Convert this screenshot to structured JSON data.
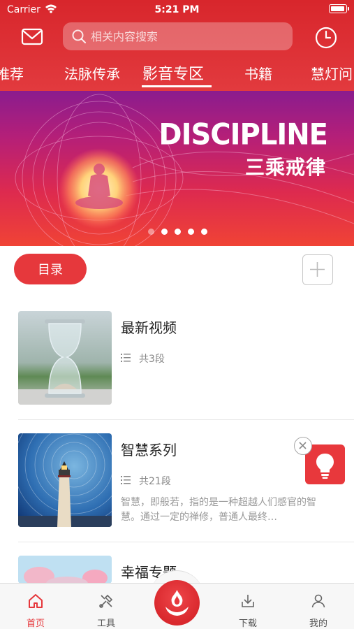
{
  "status_bar": {
    "carrier": "Carrier",
    "time": "5:21 PM"
  },
  "search": {
    "placeholder": "相关内容搜索"
  },
  "tabs": [
    {
      "label": "推荐"
    },
    {
      "label": "法脉传承"
    },
    {
      "label": "影音专区"
    },
    {
      "label": "书籍"
    },
    {
      "label": "慧灯问"
    }
  ],
  "banner": {
    "title": "DISCIPLINE",
    "subtitle": "三乘戒律",
    "slide_count": 5,
    "active_slide": 1
  },
  "catalog_button": "目录",
  "items": [
    {
      "title": "最新视频",
      "count": "共3段",
      "description": ""
    },
    {
      "title": "智慧系列",
      "count": "共21段",
      "description": "智慧，即般若，指的是一种超越人们感官的智慧。通过一定的禅修，普通人最终…"
    },
    {
      "title": "幸福专题",
      "count": "",
      "description": ""
    }
  ],
  "tabbar": [
    {
      "label": "首页",
      "icon": "home-icon",
      "active": true
    },
    {
      "label": "工具",
      "icon": "tools-icon",
      "active": false
    },
    {
      "label": "",
      "icon": "flame-lotus-icon",
      "active": false
    },
    {
      "label": "下载",
      "icon": "download-icon",
      "active": false
    },
    {
      "label": "我的",
      "icon": "user-icon",
      "active": false
    }
  ],
  "colors": {
    "brand_red": "#e6383c",
    "tab_active": "#e6383c",
    "header_red": "#d8262c"
  }
}
